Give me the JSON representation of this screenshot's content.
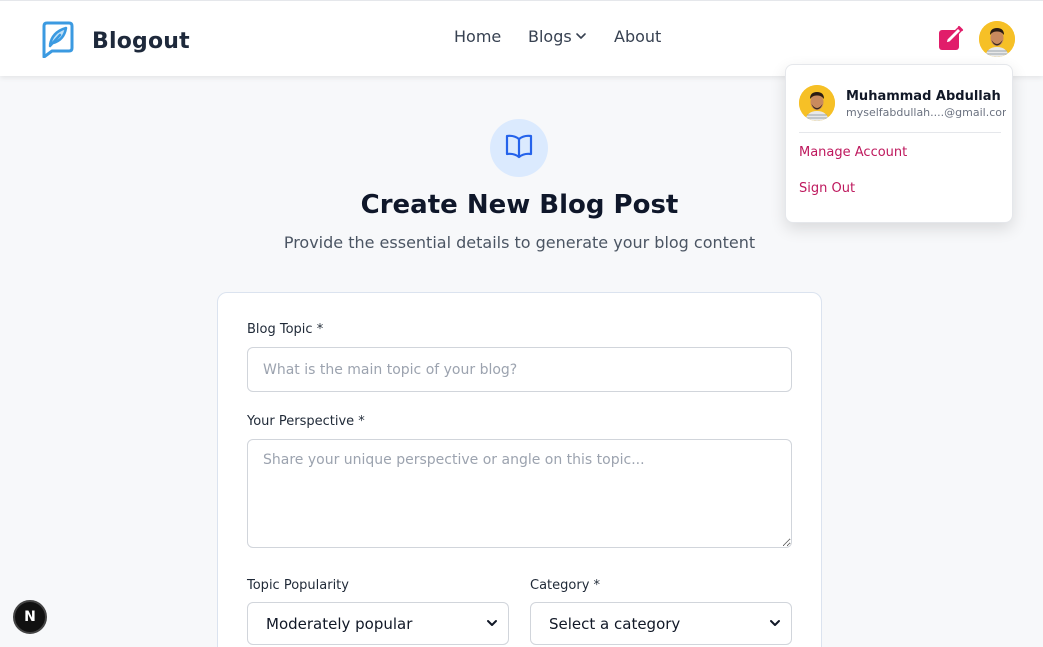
{
  "brand": {
    "name": "Blogout",
    "accent": "#3b9ae1"
  },
  "nav": {
    "home": "Home",
    "blogs": "Blogs",
    "about": "About"
  },
  "user_menu": {
    "name": "Muhammad Abdullah",
    "email": "myselfabdullah....@gmail.com",
    "manage_account": "Manage Account",
    "sign_out": "Sign Out",
    "accent": "#be185d"
  },
  "page": {
    "title": "Create New Blog Post",
    "subtitle": "Provide the essential details to generate your blog content"
  },
  "form": {
    "topic_label": "Blog Topic *",
    "topic_placeholder": "What is the main topic of your blog?",
    "perspective_label": "Your Perspective *",
    "perspective_placeholder": "Share your unique perspective or angle on this topic...",
    "popularity_label": "Topic Popularity",
    "popularity_value": "Moderately popular",
    "category_label": "Category *",
    "category_value": "Select a category"
  },
  "dev_badge": "N",
  "icons": {
    "logo": "feather-pen-icon",
    "write": "edit-square-icon",
    "hero": "open-book-icon",
    "blogs_dropdown": "chevron-down-icon",
    "select": "chevron-down-icon"
  },
  "colors": {
    "write_button": "#e11d6a",
    "hero_circle": "#dbeafe",
    "hero_icon": "#2563eb"
  }
}
